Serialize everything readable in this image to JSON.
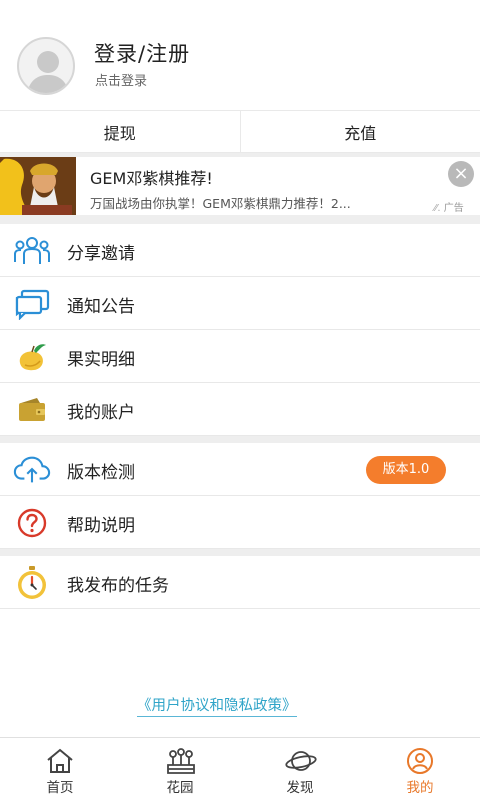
{
  "profile": {
    "title": "登录/注册",
    "subtitle": "点击登录"
  },
  "actions": {
    "withdraw": "提现",
    "recharge": "充值"
  },
  "ad": {
    "title": "GEM邓紫棋推荐!",
    "desc": "万国战场由你执掌！GEM邓紫棋鼎力推荐！2...",
    "label": "广告",
    "close": "×"
  },
  "menu": {
    "share": "分享邀请",
    "notice": "通知公告",
    "fruit": "果实明细",
    "account": "我的账户",
    "version": "版本检测",
    "version_badge": "版本1.0",
    "help": "帮助说明",
    "tasks": "我发布的任务"
  },
  "policy": "《用户协议和隐私政策》",
  "tabs": {
    "home": "首页",
    "garden": "花园",
    "discover": "发现",
    "mine": "我的"
  },
  "colors": {
    "accent": "#f47d2c",
    "blue": "#2fa4c8",
    "active_tab": "#e8782a"
  }
}
